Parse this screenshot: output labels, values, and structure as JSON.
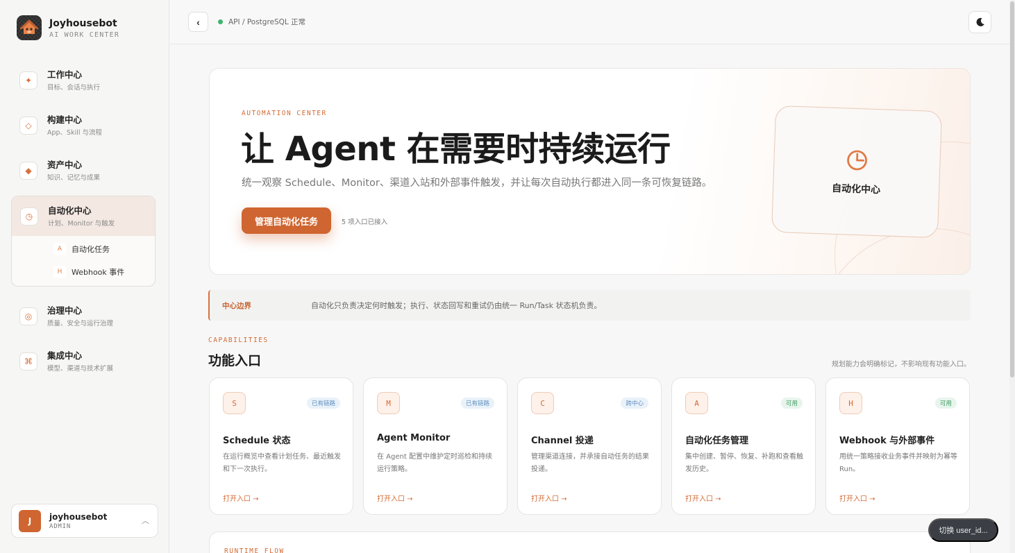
{
  "brand": {
    "name": "Joyhousebot",
    "subtitle": "AI WORK CENTER"
  },
  "nav": {
    "items": [
      {
        "title": "工作中心",
        "desc": "目标、会话与执行",
        "icon": "sparkle-icon",
        "glyph": "✦"
      },
      {
        "title": "构建中心",
        "desc": "App、Skill 与流程",
        "icon": "diamond-outline-icon",
        "glyph": "◇"
      },
      {
        "title": "资产中心",
        "desc": "知识、记忆与成果",
        "icon": "diamond-filled-icon",
        "glyph": "◆"
      }
    ],
    "active": {
      "title": "自动化中心",
      "desc": "计划、Monitor 与触发",
      "icon": "clock-icon",
      "glyph": "◷"
    },
    "sub_items": [
      {
        "badge": "A",
        "label": "自动化任务"
      },
      {
        "badge": "H",
        "label": "Webhook 事件"
      }
    ],
    "after": [
      {
        "title": "治理中心",
        "desc": "质量、安全与运行治理",
        "icon": "target-icon",
        "glyph": "◎"
      },
      {
        "title": "集成中心",
        "desc": "模型、渠道与技术扩展",
        "icon": "command-icon",
        "glyph": "⌘"
      }
    ]
  },
  "user": {
    "initial": "J",
    "name": "joyhousebot",
    "role": "ADMIN"
  },
  "topbar": {
    "status": "API / PostgreSQL 正常",
    "status_color": "#3fb56a"
  },
  "hero": {
    "eyebrow": "AUTOMATION CENTER",
    "title": "让 Agent 在需要时持续运行",
    "subtitle": "统一观察 Schedule、Monitor、渠道入站和外部事件触发，并让每次自动执行都进入同一条可恢复链路。",
    "button": "管理自动化任务",
    "note": "5 项入口已接入",
    "card_label": "自动化中心"
  },
  "boundary": {
    "label": "中心边界",
    "text": "自动化只负责决定何时触发；执行、状态回写和重试仍由统一 Run/Task 状态机负责。"
  },
  "capabilities": {
    "eyebrow": "CAPABILITIES",
    "title": "功能入口",
    "note": "规划能力会明确标记，不影响现有功能入口。",
    "cards": [
      {
        "letter": "S",
        "badge": "已有链路",
        "badge_style": "blue",
        "title": "Schedule 状态",
        "desc": "在运行概览中查看计划任务、最近触发和下一次执行。",
        "link": "打开入口 →"
      },
      {
        "letter": "M",
        "badge": "已有链路",
        "badge_style": "blue",
        "title": "Agent Monitor",
        "desc": "在 Agent 配置中维护定时巡检和持续运行策略。",
        "link": "打开入口 →"
      },
      {
        "letter": "C",
        "badge": "跨中心",
        "badge_style": "blue",
        "title": "Channel 投递",
        "desc": "管理渠道连接，并承接自动任务的结果投递。",
        "link": "打开入口 →"
      },
      {
        "letter": "A",
        "badge": "可用",
        "badge_style": "green",
        "title": "自动化任务管理",
        "desc": "集中创建、暂停、恢复、补跑和查看触发历史。",
        "link": "打开入口 →"
      },
      {
        "letter": "H",
        "badge": "可用",
        "badge_style": "green",
        "title": "Webhook 与外部事件",
        "desc": "用统一策略接收业务事件并映射为幂等 Run。",
        "link": "打开入口 →"
      }
    ]
  },
  "runtime": {
    "eyebrow": "RUNTIME FLOW"
  },
  "switch_user": "切换 user_id..."
}
